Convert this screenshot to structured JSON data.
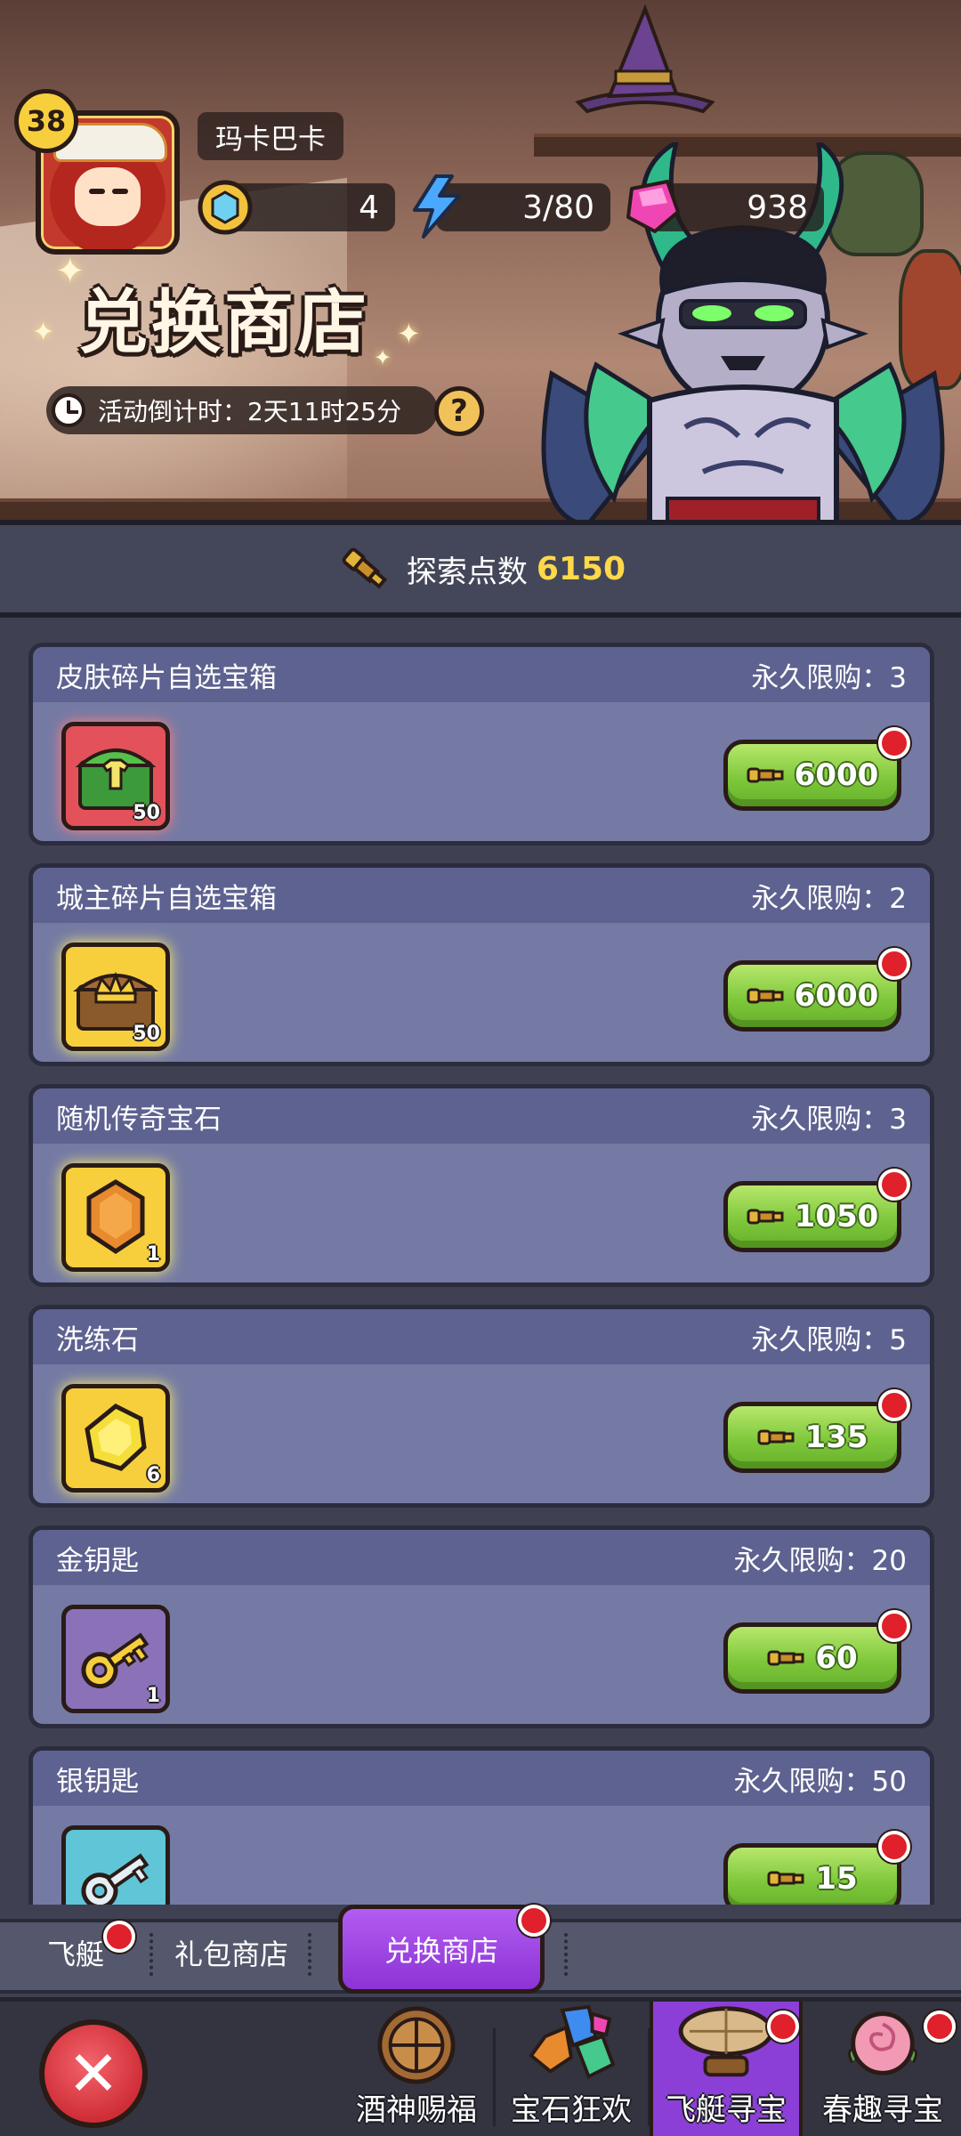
{
  "header": {
    "level": "38",
    "player_name": "玛卡巴卡",
    "resources": [
      {
        "icon": "coin-icon",
        "value": "4"
      },
      {
        "icon": "energy-lightning-icon",
        "value": "3/80"
      },
      {
        "icon": "pink-gem-icon",
        "value": "938"
      }
    ],
    "title": "兑换商店",
    "countdown": "活动倒计时：2天11时25分",
    "help_icon": "question-icon"
  },
  "points": {
    "label": "探索点数",
    "value": "6150",
    "icon": "spyglass-icon"
  },
  "items": [
    {
      "name": "皮肤碎片自选宝箱",
      "limit": "永久限购：3",
      "count": "50",
      "price": "6000",
      "icon": "skin-chest-icon",
      "frame": "red"
    },
    {
      "name": "城主碎片自选宝箱",
      "limit": "永久限购：2",
      "count": "50",
      "price": "6000",
      "icon": "crown-chest-icon",
      "frame": "gold"
    },
    {
      "name": "随机传奇宝石",
      "limit": "永久限购：3",
      "count": "1",
      "price": "1050",
      "icon": "orange-gem-icon",
      "frame": "gold"
    },
    {
      "name": "洗练石",
      "limit": "永久限购：5",
      "count": "6",
      "price": "135",
      "icon": "yellow-stone-icon",
      "frame": "gold"
    },
    {
      "name": "金钥匙",
      "limit": "永久限购：20",
      "count": "1",
      "price": "60",
      "icon": "gold-key-icon",
      "frame": "purple"
    },
    {
      "name": "银钥匙",
      "limit": "永久限购：50",
      "count": "",
      "price": "15",
      "icon": "silver-key-icon",
      "frame": "blue"
    }
  ],
  "tabs": [
    {
      "label": "飞艇"
    },
    {
      "label": "礼包商店"
    },
    {
      "label": "兑换商店",
      "active": true
    }
  ],
  "bottom_nav": [
    {
      "label": "酒神赐福",
      "icon": "wine-barrel-icon"
    },
    {
      "label": "宝石狂欢",
      "icon": "gems-pile-icon"
    },
    {
      "label": "飞艇寻宝",
      "icon": "airship-icon",
      "active": true
    },
    {
      "label": "春趣寻宝",
      "icon": "rose-icon"
    }
  ],
  "colors": {
    "accent_purple": "#8c33d6",
    "buy_green": "#7fc83c",
    "points_gold": "#ffd84a",
    "card_bg": "#757aa4",
    "notify_red": "#e0202a"
  }
}
